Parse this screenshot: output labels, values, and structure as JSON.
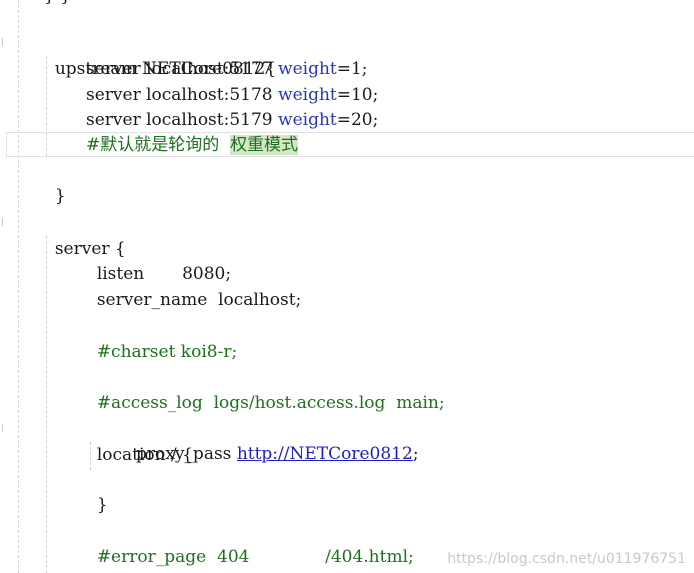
{
  "editor": {
    "top_fragment": "}  }",
    "lines": {
      "upstream": "upstream NETCore0812{",
      "server1_prefix": "server localhost:5177 ",
      "server1_kw": "weight",
      "server1_suffix": "=1;",
      "server2_prefix": "server localhost:5178 ",
      "server2_kw": "weight",
      "server2_suffix": "=10;",
      "server3_prefix": "server localhost:5179 ",
      "server3_kw": "weight",
      "server3_suffix": "=20;",
      "comment_default": "#默认就是轮询的  ",
      "comment_weight_mode": "权重模式",
      "close_brace1": "}",
      "server_block": "server {",
      "listen": "listen       8080;",
      "server_name": "server_name  localhost;",
      "charset": "#charset koi8-r;",
      "access_log": "#access_log  logs/host.access.log  main;",
      "location": "location / {",
      "proxy_pass_prefix": "proxy_pass ",
      "proxy_pass_url": "http://NETCore0812",
      "proxy_pass_suffix": ";",
      "close_brace2": "}",
      "error_page": "#error_page  404              /404.html;"
    }
  },
  "watermark": "https://blog.csdn.net/u011976751",
  "colors": {
    "keyword": "#2a37b8",
    "comment": "#1f6f1f",
    "highlight": "#d4e7c6",
    "link": "#2020c0"
  }
}
